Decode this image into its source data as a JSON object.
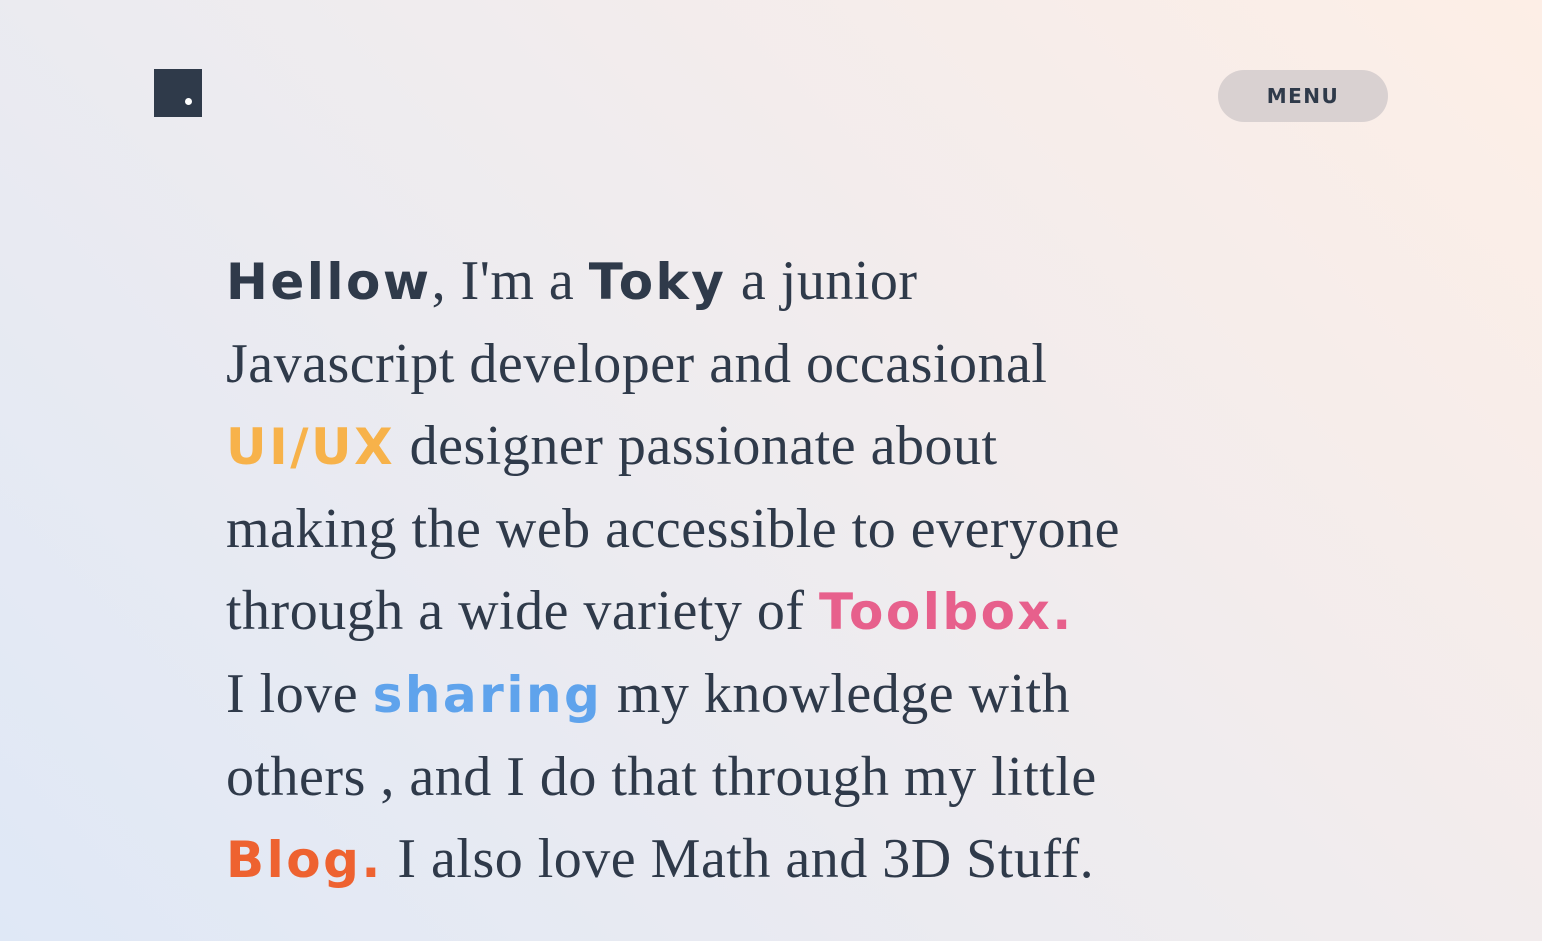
{
  "header": {
    "logo_icon": "square-logo-icon",
    "menu_label": "MENU"
  },
  "intro": {
    "greeting": "Hellow",
    "t1": ", I'm a ",
    "name": "Toky",
    "t2": " a junior",
    "line2": "Javascript developer and occasional",
    "uiux": "UI/UX",
    "t3": " designer passionate about",
    "line4": "making the web accessible to everyone",
    "t4": "through a wide variety of ",
    "toolbox": "Toolbox.",
    "t5": "I love ",
    "sharing": "sharing",
    "t6": " my knowledge with",
    "line7": "others , and I do that through my little",
    "blog": "Blog.",
    "t7": " I also love Math and 3D Stuff."
  },
  "colors": {
    "text": "#2f3a4a",
    "uiux": "#f7b24a",
    "toolbox": "#e7608c",
    "sharing": "#5fa3ec",
    "blog": "#ee6230",
    "menu_bg": "#d9d1d1"
  }
}
